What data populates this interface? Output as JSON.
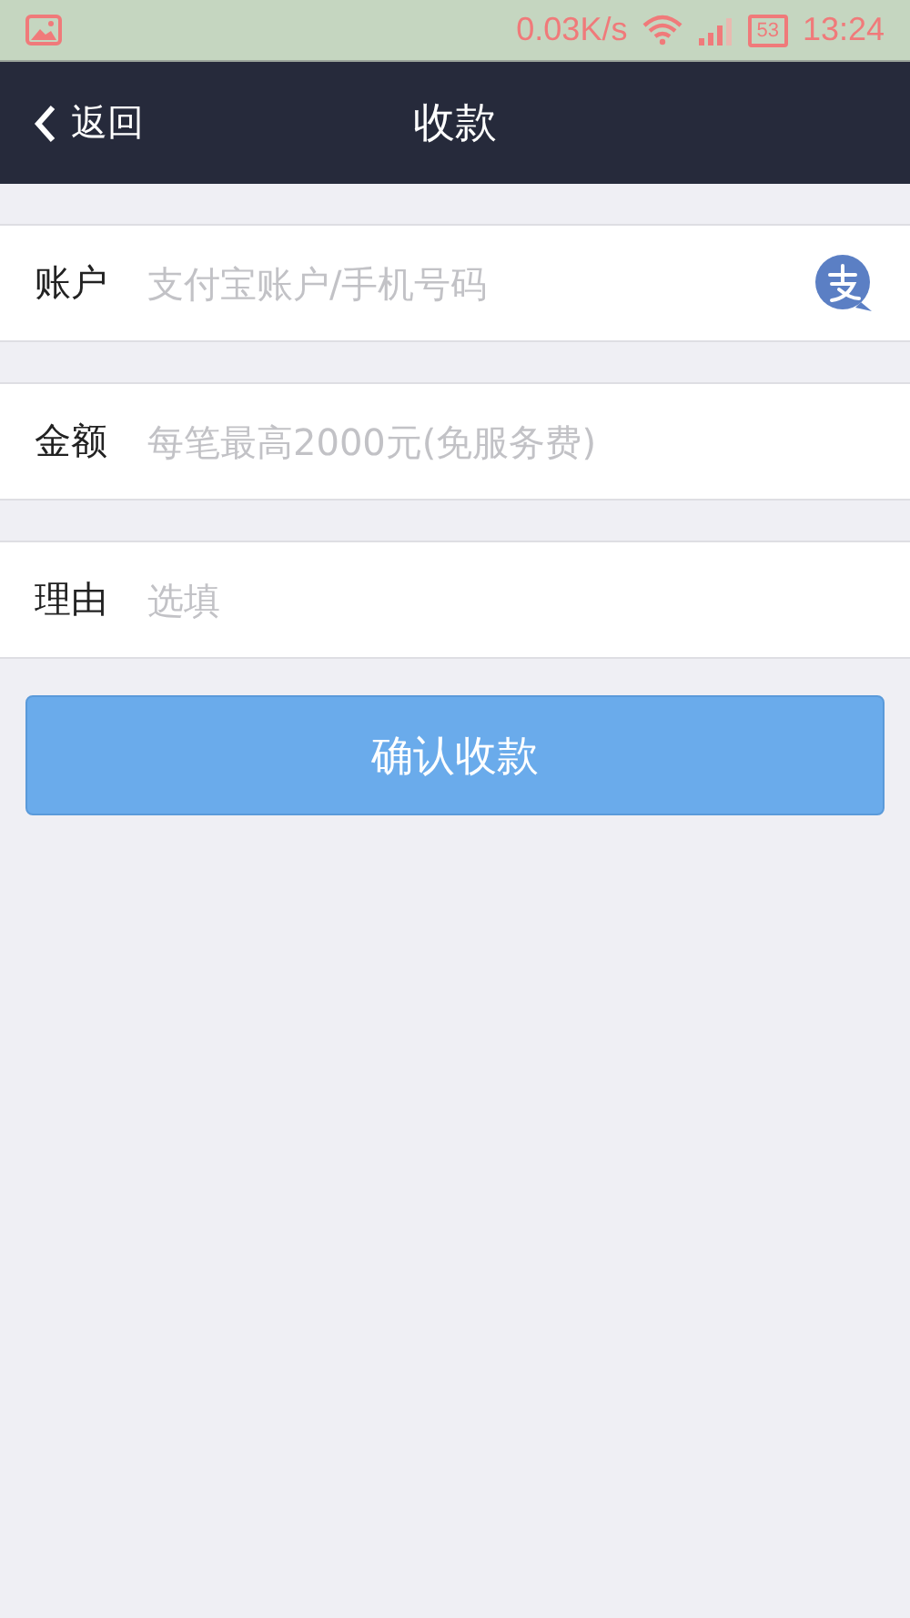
{
  "status_bar": {
    "speed": "0.03K/s",
    "battery": "53",
    "time": "13:24"
  },
  "nav": {
    "back": "返回",
    "title": "收款"
  },
  "fields": [
    {
      "label": "账户",
      "placeholder": "支付宝账户/手机号码",
      "kind": "account"
    },
    {
      "label": "金额",
      "placeholder": "每笔最高2000元(免服务费)",
      "kind": "plain"
    },
    {
      "label": "理由",
      "placeholder": "选填",
      "kind": "plain"
    }
  ],
  "confirm_button": "确认收款"
}
